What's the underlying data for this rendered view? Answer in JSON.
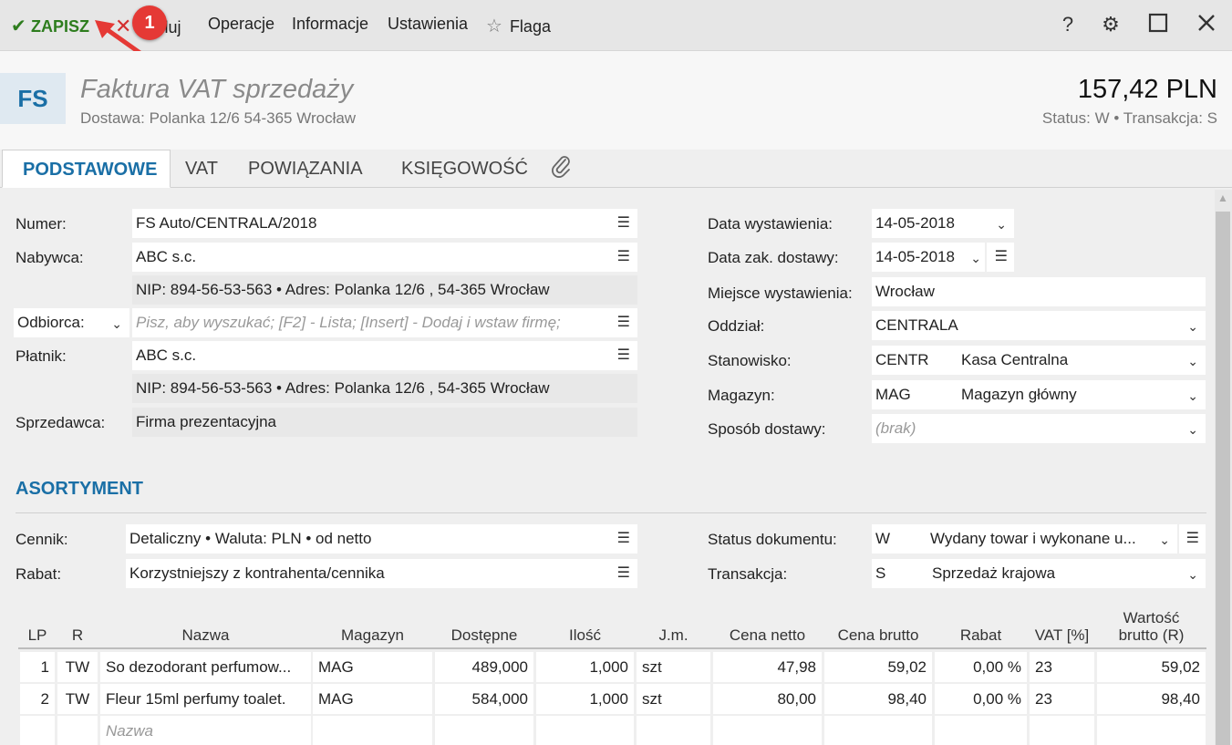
{
  "toolbar": {
    "save": "ZAPISZ",
    "cancel": "Anuluj",
    "operations": "Operacje",
    "information": "Informacje",
    "settings": "Ustawienia",
    "flag": "Flaga",
    "badge": "1"
  },
  "header": {
    "code": "FS",
    "title": "Faktura VAT sprzedaży",
    "delivery": "Dostawa: Polanka  12/6  54-365 Wrocław",
    "amount": "157,42 PLN",
    "status_line": "Status:  W  •  Transakcja:  S"
  },
  "tabs": [
    "PODSTAWOWE",
    "VAT",
    "POWIĄZANIA",
    "KSIĘGOWOŚĆ"
  ],
  "left": {
    "numer_label": "Numer:",
    "numer": "FS Auto/CENTRALA/2018",
    "nabywca_label": "Nabywca:",
    "nabywca": "ABC s.c.",
    "nabywca_info": "NIP:  894-56-53-563  •  Adres:  Polanka  12/6 , 54-365 Wrocław",
    "odbiorca_select": "Odbiorca:",
    "odbiorca_placeholder": "Pisz, aby wyszukać; [F2] - Lista; [Insert] - Dodaj i wstaw firmę;",
    "platnik_label": "Płatnik:",
    "platnik": "ABC s.c.",
    "platnik_info": "NIP:  894-56-53-563  •  Adres:  Polanka  12/6 , 54-365 Wrocław",
    "sprzedawca_label": "Sprzedawca:",
    "sprzedawca": "Firma prezentacyjna"
  },
  "right": {
    "data_wyst_label": "Data wystawienia:",
    "data_wyst": "14-05-2018",
    "data_dost_label": "Data zak. dostawy:",
    "data_dost": "14-05-2018",
    "miejsce_label": "Miejsce wystawienia:",
    "miejsce": "Wrocław",
    "oddzial_label": "Oddział:",
    "oddzial": "CENTRALA",
    "stanowisko_label": "Stanowisko:",
    "stanowisko_code": "CENTR",
    "stanowisko": "Kasa Centralna",
    "magazyn_label": "Magazyn:",
    "magazyn_code": "MAG",
    "magazyn": "Magazyn główny",
    "sposob_label": "Sposób dostawy:",
    "sposob_placeholder": "(brak)"
  },
  "asortyment": {
    "title": "ASORTYMENT",
    "cennik_label": "Cennik:",
    "cennik": "Detaliczny • Waluta: PLN • od netto",
    "rabat_label": "Rabat:",
    "rabat": "Korzystniejszy z kontrahenta/cennika",
    "status_label": "Status dokumentu:",
    "status_code": "W",
    "status": "Wydany towar i wykonane u...",
    "transakcja_label": "Transakcja:",
    "transakcja_code": "S",
    "transakcja": "Sprzedaż krajowa"
  },
  "table": {
    "headers": {
      "lp": "LP",
      "r": "R",
      "nazwa": "Nazwa",
      "magazyn": "Magazyn",
      "dostepne": "Dostępne",
      "ilosc": "Ilość",
      "jm": "J.m.",
      "cena_netto": "Cena netto",
      "cena_brutto": "Cena brutto",
      "rabat": "Rabat",
      "vat": "VAT [%]",
      "wartosc_1": "Wartość",
      "wartosc_2": "brutto (R)"
    },
    "rows": [
      {
        "lp": "1",
        "r": "TW",
        "nazwa": "So dezodorant perfumow...",
        "magazyn": "MAG",
        "dostepne": "489,000",
        "ilosc": "1,000",
        "jm": "szt",
        "cena_netto": "47,98",
        "cena_brutto": "59,02",
        "rabat": "0,00 %",
        "vat": "23",
        "wartosc": "59,02"
      },
      {
        "lp": "2",
        "r": "TW",
        "nazwa": "Fleur 15ml perfumy toalet.",
        "magazyn": "MAG",
        "dostepne": "584,000",
        "ilosc": "1,000",
        "jm": "szt",
        "cena_netto": "80,00",
        "cena_brutto": "98,40",
        "rabat": "0,00 %",
        "vat": "23",
        "wartosc": "98,40"
      }
    ],
    "new_row_placeholder": "Nazwa"
  },
  "colors": {
    "accent": "#1a6fa6",
    "save": "#2e7d1e",
    "cancel": "#d32f2f",
    "badge": "#e53935"
  }
}
